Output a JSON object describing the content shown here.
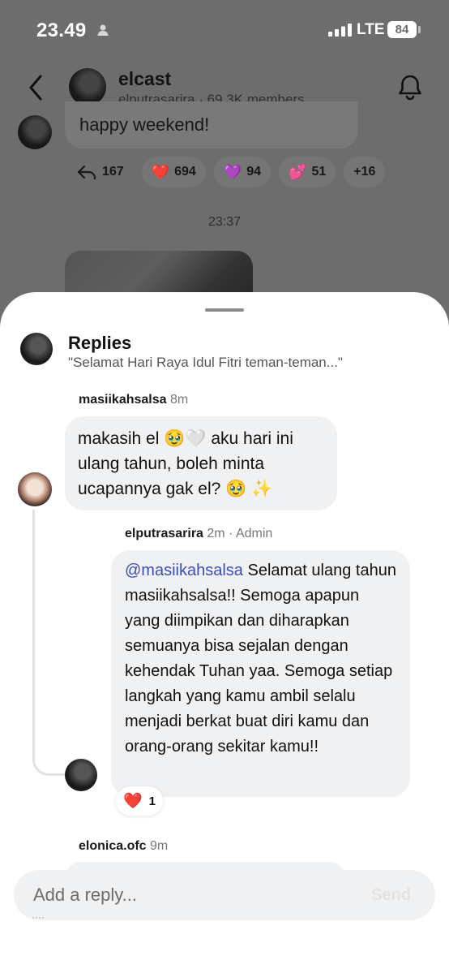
{
  "status_bar": {
    "time": "23.49",
    "network": "LTE",
    "battery": "84"
  },
  "header": {
    "channel_name": "elcast",
    "subtitle": "elputrasarira · 69,3K members"
  },
  "background_chat": {
    "message_text": "happy weekend!",
    "reactions": [
      {
        "icon": "reply-icon",
        "count": "167"
      },
      {
        "emoji": "❤️",
        "count": "694"
      },
      {
        "emoji": "💜",
        "count": "94"
      },
      {
        "emoji": "💕",
        "count": "51"
      },
      {
        "more": "+16"
      }
    ],
    "time_divider": "23:37"
  },
  "sheet": {
    "title": "Replies",
    "quote": "\"Selamat Hari Raya Idul Fitri teman-teman...\"",
    "replies": [
      {
        "author": "masiikahsalsa",
        "time": "8m",
        "text": "makasih el 🥹🤍 aku hari ini ulang tahun, boleh minta ucapannya gak el? 🥹 ✨"
      },
      {
        "author": "elputrasarira",
        "time": "2m",
        "role": "Admin",
        "mention": "@masiikahsalsa",
        "text": " Selamat ulang tahun masiikahsalsa!! Semoga apapun yang diimpikan dan diharapkan semuanya bisa sejalan dengan kehendak Tuhan yaa. Semoga setiap langkah yang kamu ambil selalu menjadi berkat buat diri kamu dan orang-orang sekitar kamu!!",
        "reaction": {
          "emoji": "❤️",
          "count": "1"
        }
      },
      {
        "author": "elonica.ofc",
        "time": "9m"
      }
    ],
    "composer": {
      "placeholder": "Add a reply...",
      "send_label": "Send"
    }
  }
}
